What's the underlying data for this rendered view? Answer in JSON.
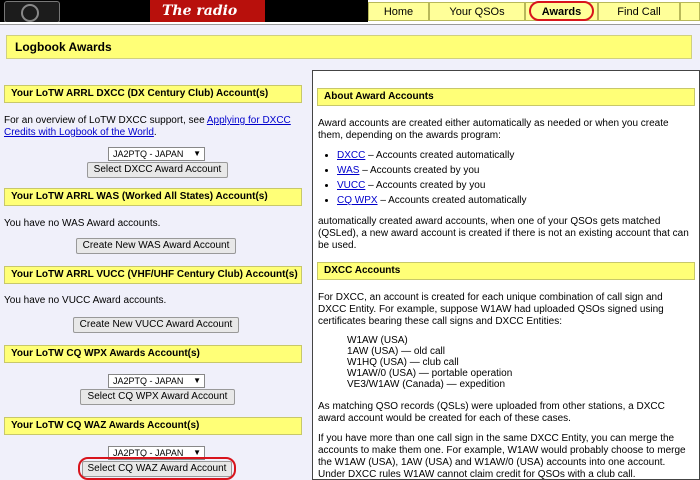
{
  "banner": {
    "slogan": "The radio",
    "nav": [
      "Home",
      "Your QSOs",
      "Awards",
      "Find Call"
    ],
    "active_nav": "Awards"
  },
  "page_title": "Logbook Awards",
  "left": {
    "dxcc": {
      "heading": "Your LoTW ARRL DXCC (DX Century Club) Account(s)",
      "text_before": "For an overview of LoTW DXCC support, see ",
      "link": "Applying for DXCC Credits with Logbook of the World",
      "text_after": ".",
      "select_value": "JA2PTQ - JAPAN",
      "button": "Select DXCC Award Account"
    },
    "was": {
      "heading": "Your LoTW ARRL WAS (Worked All States) Account(s)",
      "text": "You have no WAS Award accounts.",
      "button": "Create New WAS Award Account"
    },
    "vucc": {
      "heading": "Your LoTW ARRL VUCC (VHF/UHF Century Club) Account(s)",
      "text": "You have no VUCC Award accounts.",
      "button": "Create New VUCC Award Account"
    },
    "wpx": {
      "heading": "Your LoTW CQ WPX Awards Account(s)",
      "select_value": "JA2PTQ - JAPAN",
      "button": "Select CQ WPX Award Account"
    },
    "waz": {
      "heading": "Your LoTW CQ WAZ Awards Account(s)",
      "select_value": "JA2PTQ - JAPAN",
      "button": "Select CQ WAZ Award Account"
    }
  },
  "right": {
    "about": {
      "heading": "About Award Accounts",
      "intro": "Award accounts are created either automatically as needed or when you create them, depending on the awards program:",
      "items": [
        {
          "link": "DXCC",
          "text": " – Accounts created automatically"
        },
        {
          "link": "WAS",
          "text": " – Accounts created by you"
        },
        {
          "link": "VUCC",
          "text": " – Accounts created by you"
        },
        {
          "link": "CQ WPX",
          "text": " – Accounts created automatically"
        }
      ],
      "outro": "automatically created award accounts, when one of your QSOs gets matched (QSLed), a new award account is created if there is not an existing account that can be used."
    },
    "dxcc": {
      "heading": "DXCC Accounts",
      "p1": "For DXCC, an account is created for each unique combination of call sign and DXCC Entity. For example, suppose W1AW had uploaded QSOs signed using certificates bearing these call signs and DXCC Entities:",
      "calls": [
        "W1AW (USA)",
        "1AW (USA) — old call",
        "W1HQ (USA) — club call",
        "W1AW/0 (USA) — portable operation",
        "VE3/W1AW (Canada) — expedition"
      ],
      "p2": "As matching QSO records (QSLs) were uploaded from other stations, a DXCC award account would be created for each of these cases.",
      "p3": "If you have more than one call sign in the same DXCC Entity, you can merge the accounts to make them one. For example, W1AW would probably choose to merge the W1AW (USA), 1AW (USA) and W1AW/0 (USA) accounts into one account. Under DXCC rules W1AW cannot claim credit for QSOs with a club call."
    }
  },
  "colors": {
    "accent_yellow": "#ffff77",
    "highlight_circle": "#d8141c",
    "link": "#0000cc"
  }
}
